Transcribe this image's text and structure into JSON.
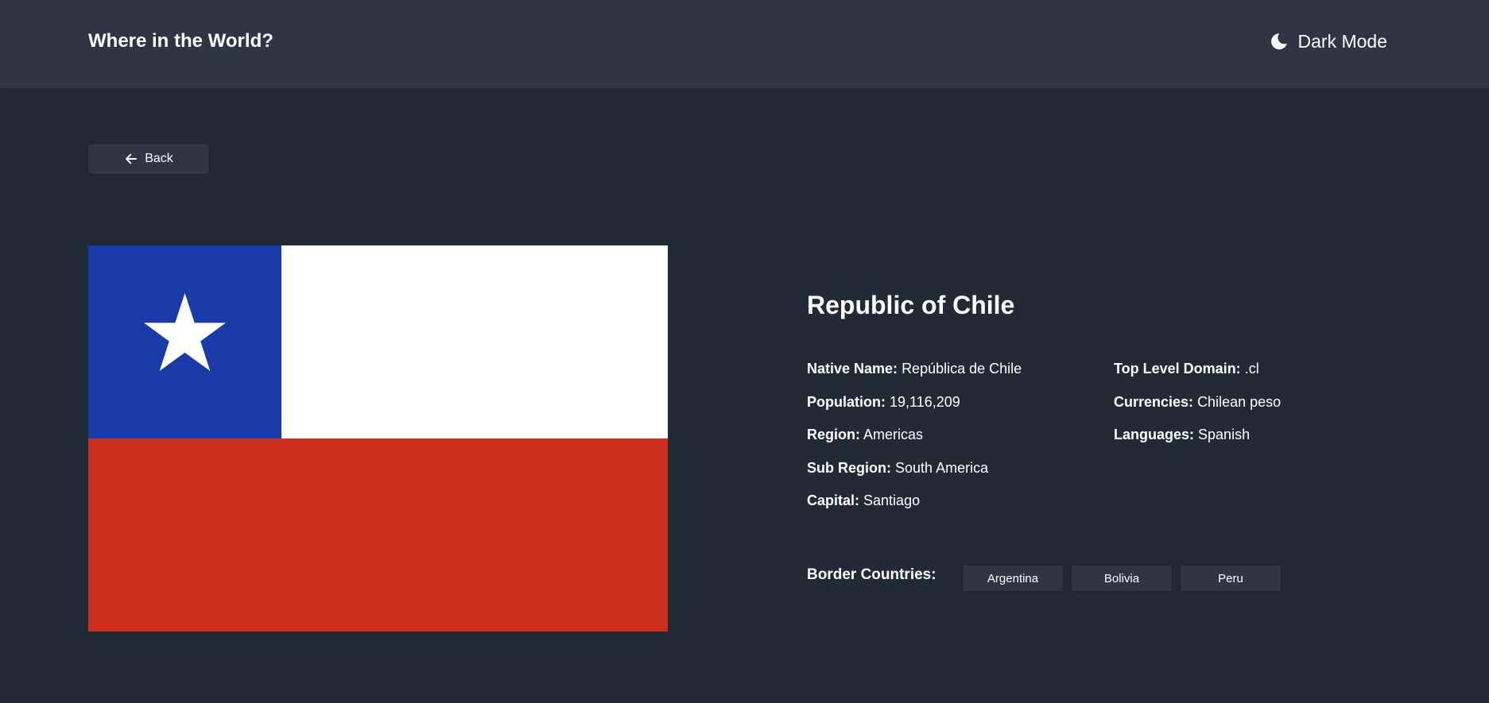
{
  "header": {
    "title": "Where in the World?",
    "mode_label": "Dark Mode",
    "mode_icon": "moon-icon"
  },
  "back_button": {
    "label": "Back",
    "icon": "arrow-left-icon"
  },
  "country": {
    "name": "Republic of Chile",
    "flag": {
      "colors": {
        "blue": "#1a3aaa",
        "white": "#ffffff",
        "red": "#cd2e1e"
      }
    },
    "details_left": [
      {
        "key": "Native Name:",
        "value": "República de Chile"
      },
      {
        "key": "Population:",
        "value": "19,116,209"
      },
      {
        "key": "Region:",
        "value": "Americas"
      },
      {
        "key": "Sub Region:",
        "value": "South America"
      },
      {
        "key": "Capital:",
        "value": "Santiago"
      }
    ],
    "details_right": [
      {
        "key": "Top Level Domain:",
        "value": ".cl"
      },
      {
        "key": "Currencies:",
        "value": "Chilean peso"
      },
      {
        "key": "Languages:",
        "value": "Spanish"
      }
    ],
    "border_label": "Border Countries:",
    "borders": [
      "Argentina",
      "Bolivia",
      "Peru"
    ]
  },
  "theme": {
    "background": "#212b36",
    "elements": "#2c3743",
    "text": "#ffffff"
  }
}
